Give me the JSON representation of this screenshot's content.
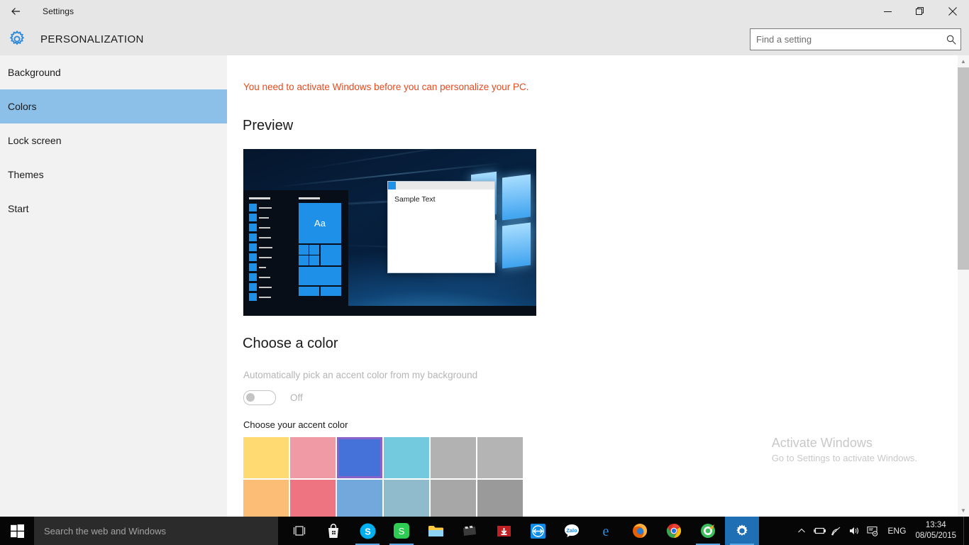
{
  "titlebar": {
    "title": "Settings",
    "back_icon": "back-arrow-icon",
    "minimize_label": "—",
    "restore_label": "❐",
    "close_label": "✕"
  },
  "header": {
    "icon": "gear-icon",
    "title": "PERSONALIZATION",
    "search_placeholder": "Find a setting",
    "search_value": "",
    "search_icon": "search-icon"
  },
  "sidebar": {
    "items": [
      {
        "label": "Background",
        "selected": false
      },
      {
        "label": "Colors",
        "selected": true
      },
      {
        "label": "Lock screen",
        "selected": false
      },
      {
        "label": "Themes",
        "selected": false
      },
      {
        "label": "Start",
        "selected": false
      }
    ]
  },
  "main": {
    "activation_warning": "You need to activate Windows before you can personalize your PC.",
    "preview_heading": "Preview",
    "preview": {
      "tile_text": "Aa",
      "window_sample_text": "Sample Text",
      "accent_color": "#1e90e8"
    },
    "color_heading": "Choose a color",
    "auto_accent_label": "Automatically pick an accent color from my background",
    "auto_accent_state": "Off",
    "auto_accent_enabled": false,
    "accent_heading": "Choose your accent color",
    "swatches": [
      {
        "color": "#ffda72",
        "selected": false
      },
      {
        "color": "#ef9aa5",
        "selected": false
      },
      {
        "color": "#4572d8",
        "selected": true
      },
      {
        "color": "#73c9de",
        "selected": false
      },
      {
        "color": "#b2b2b2",
        "selected": false
      },
      {
        "color": "#b4b4b4",
        "selected": false
      },
      {
        "color": "#fcbd76",
        "selected": false
      },
      {
        "color": "#ef7481",
        "selected": false
      },
      {
        "color": "#72a8dc",
        "selected": false
      },
      {
        "color": "#90bbcd",
        "selected": false
      },
      {
        "color": "#a7a7a7",
        "selected": false
      },
      {
        "color": "#9a9a9a",
        "selected": false
      }
    ],
    "selection_border_color": "#8a63c8"
  },
  "watermark": {
    "title": "Activate Windows",
    "subtitle": "Go to Settings to activate Windows."
  },
  "scrollbar": {
    "up_arrow": "▲",
    "down_arrow": "▼"
  },
  "taskbar": {
    "start_icon": "windows-logo-icon",
    "search_placeholder": "Search the web and Windows",
    "icons": [
      {
        "name": "task-view-icon",
        "running": false,
        "active": false
      },
      {
        "name": "store-icon",
        "running": false,
        "active": false
      },
      {
        "name": "skype-icon",
        "running": true,
        "active": false
      },
      {
        "name": "sublime-text-icon",
        "running": true,
        "active": false
      },
      {
        "name": "file-explorer-icon",
        "running": false,
        "active": false
      },
      {
        "name": "media-player-icon",
        "running": false,
        "active": false
      },
      {
        "name": "download-manager-icon",
        "running": false,
        "active": false
      },
      {
        "name": "teamviewer-icon",
        "running": false,
        "active": false
      },
      {
        "name": "zalo-icon",
        "running": false,
        "active": false
      },
      {
        "name": "edge-icon",
        "running": false,
        "active": false
      },
      {
        "name": "firefox-icon",
        "running": false,
        "active": false
      },
      {
        "name": "chrome-icon",
        "running": false,
        "active": false
      },
      {
        "name": "coccoc-icon",
        "running": true,
        "active": false
      },
      {
        "name": "settings-icon",
        "running": true,
        "active": true
      }
    ],
    "tray": {
      "chevron": "∧",
      "battery_icon": "battery-icon",
      "network_icon": "wifi-icon",
      "volume_icon": "speaker-icon",
      "action_center_icon": "action-center-icon",
      "language": "ENG",
      "time": "13:34",
      "date": "08/05/2015"
    }
  }
}
